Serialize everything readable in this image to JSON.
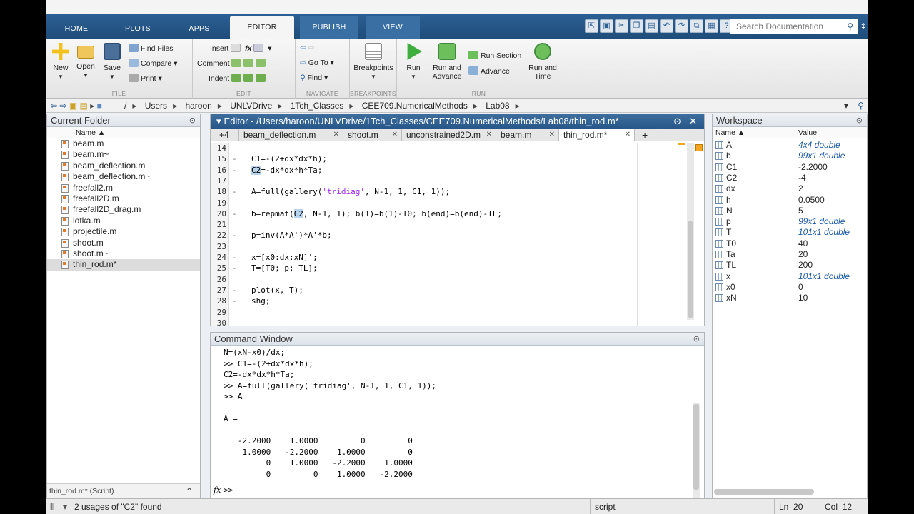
{
  "tabs": [
    "HOME",
    "PLOTS",
    "APPS",
    "EDITOR",
    "PUBLISH",
    "VIEW"
  ],
  "search_placeholder": "Search Documentation",
  "toolstrip": {
    "file": {
      "new": "New",
      "open": "Open",
      "save": "Save",
      "find_files": "Find Files",
      "compare": "Compare",
      "print": "Print",
      "caption": "FILE"
    },
    "edit": {
      "insert": "Insert",
      "comment": "Comment",
      "indent": "Indent",
      "fx": "fx",
      "caption": "EDIT"
    },
    "navigate": {
      "goto": "Go To",
      "find": "Find",
      "caption": "NAVIGATE"
    },
    "breakpoints": {
      "label": "Breakpoints",
      "caption": "BREAKPOINTS"
    },
    "run": {
      "run": "Run",
      "run_advance_1": "Run and",
      "run_advance_2": "Advance",
      "run_section": "Run Section",
      "advance": "Advance",
      "run_time_1": "Run and",
      "run_time_2": "Time",
      "caption": "RUN"
    }
  },
  "path": [
    "/",
    "Users",
    "haroon",
    "UNLVDrive",
    "1Tch_Classes",
    "CEE709.NumericalMethods",
    "Lab08"
  ],
  "current_folder": {
    "title": "Current Folder",
    "column_name": "Name ▲",
    "files": [
      "beam.m",
      "beam.m~",
      "beam_deflection.m",
      "beam_deflection.m~",
      "freefall2.m",
      "freefall2D.m",
      "freefall2D_drag.m",
      "lotka.m",
      "projectile.m",
      "shoot.m",
      "shoot.m~",
      "thin_rod.m*"
    ],
    "footer": "thin_rod.m* (Script)"
  },
  "editor": {
    "title": "Editor - /Users/haroon/UNLVDrive/1Tch_Classes/CEE709.NumericalMethods/Lab08/thin_rod.m*",
    "more_tabs": "+4",
    "tabs": [
      "beam_deflection.m",
      "shoot.m",
      "unconstrained2D.m",
      "beam.m",
      "thin_rod.m*"
    ],
    "add_tab": "+",
    "lines": [
      {
        "n": "14",
        "dash": "",
        "code": ""
      },
      {
        "n": "15",
        "dash": "-",
        "code": "C1=-(2+dx*dx*h);"
      },
      {
        "n": "16",
        "dash": "-",
        "pre": "",
        "hl": "C2",
        "post": "=-dx*dx*h*Ta;"
      },
      {
        "n": "17",
        "dash": "",
        "code": ""
      },
      {
        "n": "18",
        "dash": "-",
        "pre": "A=full(gallery(",
        "str": "'tridiag'",
        "post": ", N-1, 1, C1, 1));"
      },
      {
        "n": "19",
        "dash": "",
        "code": ""
      },
      {
        "n": "20",
        "dash": "-",
        "pre": "b=repmat(",
        "hl": "C2",
        "post": ", N-1, 1); b(1)=b(1)-T0; b(end)=b(end)-TL;"
      },
      {
        "n": "21",
        "dash": "",
        "code": ""
      },
      {
        "n": "22",
        "dash": "-",
        "code": "p=inv(A*A')*A'*b;"
      },
      {
        "n": "23",
        "dash": "",
        "code": ""
      },
      {
        "n": "24",
        "dash": "-",
        "code": "x=[x0:dx:xN]';"
      },
      {
        "n": "25",
        "dash": "-",
        "code": "T=[T0; p; TL];"
      },
      {
        "n": "26",
        "dash": "",
        "code": ""
      },
      {
        "n": "27",
        "dash": "-",
        "code": "plot(x, T);"
      },
      {
        "n": "28",
        "dash": "-",
        "code": "shg;"
      },
      {
        "n": "29",
        "dash": "",
        "code": ""
      },
      {
        "n": "30",
        "dash": "",
        "code": ""
      }
    ]
  },
  "command_window": {
    "title": "Command Window",
    "lines": [
      "N=(xN-x0)/dx;",
      ">> C1=-(2+dx*dx*h);",
      "C2=-dx*dx*h*Ta;",
      ">> A=full(gallery('tridiag', N-1, 1, C1, 1));",
      ">> A",
      "",
      "A =",
      "",
      "   -2.2000    1.0000         0         0",
      "    1.0000   -2.2000    1.0000         0",
      "         0    1.0000   -2.2000    1.0000",
      "         0         0    1.0000   -2.2000"
    ],
    "prompt_fx": "fx",
    "prompt": ">>"
  },
  "workspace": {
    "title": "Workspace",
    "col_name": "Name ▲",
    "col_value": "Value",
    "vars": [
      {
        "name": "A",
        "value": "4x4 double",
        "italic": true
      },
      {
        "name": "b",
        "value": "99x1 double",
        "italic": true
      },
      {
        "name": "C1",
        "value": "-2.2000",
        "italic": false
      },
      {
        "name": "C2",
        "value": "-4",
        "italic": false
      },
      {
        "name": "dx",
        "value": "2",
        "italic": false
      },
      {
        "name": "h",
        "value": "0.0500",
        "italic": false
      },
      {
        "name": "N",
        "value": "5",
        "italic": false
      },
      {
        "name": "p",
        "value": "99x1 double",
        "italic": true
      },
      {
        "name": "T",
        "value": "101x1 double",
        "italic": true
      },
      {
        "name": "T0",
        "value": "40",
        "italic": false
      },
      {
        "name": "Ta",
        "value": "20",
        "italic": false
      },
      {
        "name": "TL",
        "value": "200",
        "italic": false
      },
      {
        "name": "x",
        "value": "101x1 double",
        "italic": true
      },
      {
        "name": "x0",
        "value": "0",
        "italic": false
      },
      {
        "name": "xN",
        "value": "10",
        "italic": false
      }
    ]
  },
  "status": {
    "message": "2 usages of \"C2\" found",
    "mode": "script",
    "ln_label": "Ln",
    "ln": "20",
    "col_label": "Col",
    "col": "12"
  },
  "colors": {
    "titlebar": "#27578a",
    "string": "#a020f0",
    "highlight": "#b8d4ee"
  }
}
